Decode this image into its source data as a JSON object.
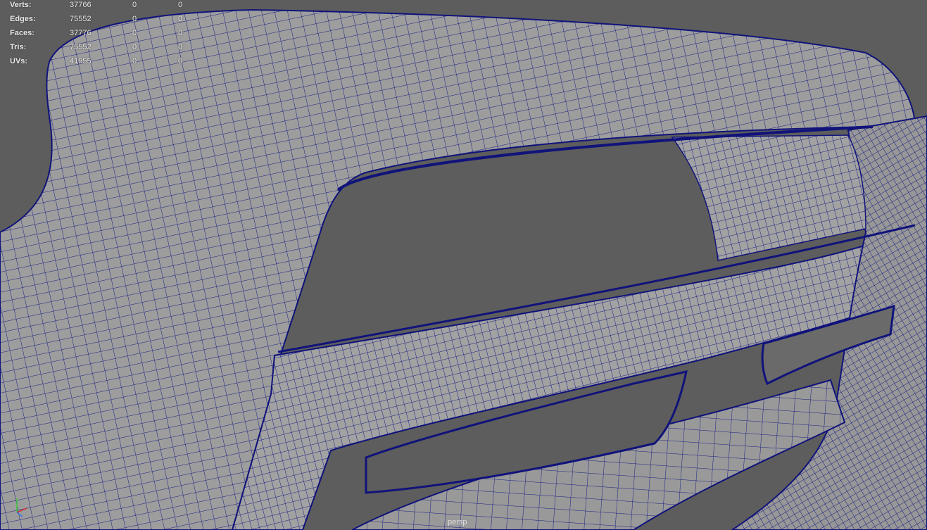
{
  "hud": {
    "rows": [
      {
        "label": "Verts:",
        "total": "37766",
        "selected": "0",
        "component": "0"
      },
      {
        "label": "Edges:",
        "total": "75552",
        "selected": "0",
        "component": "0"
      },
      {
        "label": "Faces:",
        "total": "37776",
        "selected": "0",
        "component": "0"
      },
      {
        "label": "Tris:",
        "total": "75552",
        "selected": "0",
        "component": "0"
      },
      {
        "label": "UVs:",
        "total": "41955",
        "selected": "0",
        "component": "0"
      }
    ]
  },
  "camera": {
    "name": "persp"
  },
  "axis_indicator": {
    "icon": "xyz-axis-gizmo-icon",
    "x_color": "#d23232",
    "y_color": "#3cc83c",
    "z_color": "#3c78dc"
  },
  "colors": {
    "background": "#5d5d5d",
    "surface": "#9b9b9b",
    "wire": "#10137a"
  }
}
